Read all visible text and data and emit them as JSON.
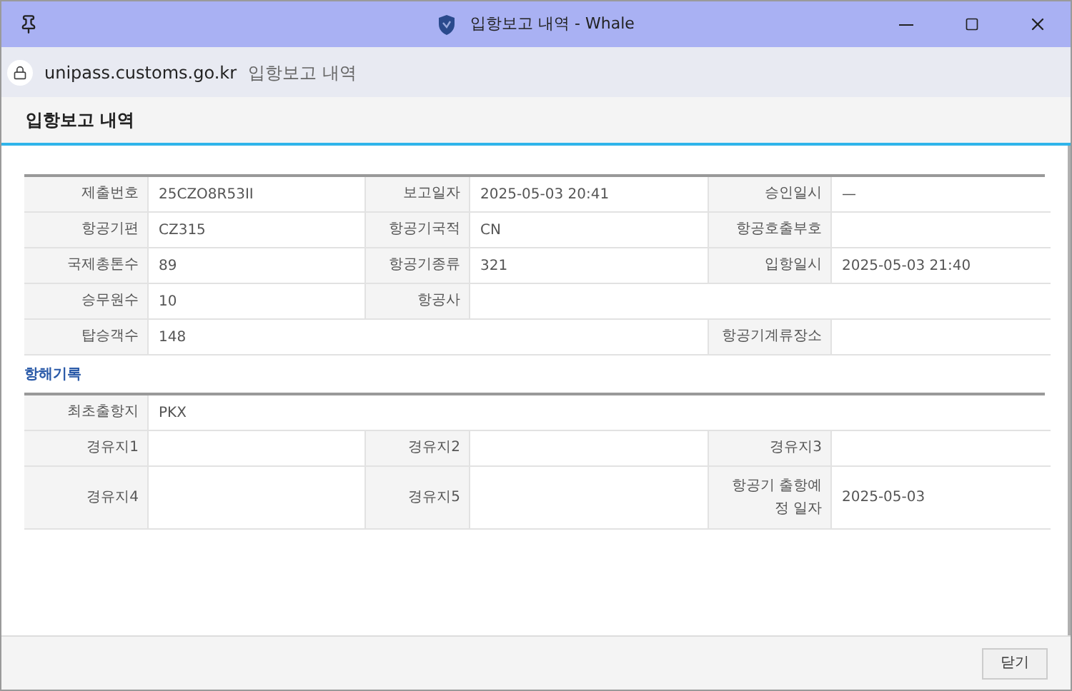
{
  "window": {
    "title": "입항보고 내역 - Whale"
  },
  "address_bar": {
    "url": "unipass.customs.go.kr",
    "page_title": "입항보고 내역"
  },
  "page": {
    "heading": "입항보고 내역"
  },
  "report_table": {
    "rows": [
      [
        {
          "kind": "label",
          "text": "제출번호"
        },
        {
          "kind": "value",
          "text": "25CZO8R53II"
        },
        {
          "kind": "label",
          "text": "보고일자"
        },
        {
          "kind": "value",
          "text": "2025-05-03 20:41"
        },
        {
          "kind": "label",
          "text": "승인일시"
        },
        {
          "kind": "value",
          "text": "—"
        }
      ],
      [
        {
          "kind": "label",
          "text": "항공기편"
        },
        {
          "kind": "value",
          "text": "CZ315"
        },
        {
          "kind": "label",
          "text": "항공기국적"
        },
        {
          "kind": "value",
          "text": "CN"
        },
        {
          "kind": "label",
          "text": "항공호출부호"
        },
        {
          "kind": "value",
          "text": ""
        }
      ],
      [
        {
          "kind": "label",
          "text": "국제총톤수"
        },
        {
          "kind": "value",
          "text": "89"
        },
        {
          "kind": "label",
          "text": "항공기종류"
        },
        {
          "kind": "value",
          "text": "321"
        },
        {
          "kind": "label",
          "text": "입항일시"
        },
        {
          "kind": "value",
          "text": "2025-05-03 21:40"
        }
      ],
      [
        {
          "kind": "label",
          "text": "승무원수"
        },
        {
          "kind": "value",
          "text": "10"
        },
        {
          "kind": "label",
          "text": "항공사"
        },
        {
          "kind": "value",
          "text": ""
        },
        {
          "kind": "value",
          "text": ""
        },
        {
          "kind": "value",
          "text": ""
        }
      ],
      [
        {
          "kind": "label",
          "text": "탑승객수"
        },
        {
          "kind": "value",
          "text": "148"
        },
        {
          "kind": "value",
          "text": ""
        },
        {
          "kind": "value",
          "text": ""
        },
        {
          "kind": "label",
          "text": "항공기계류장소"
        },
        {
          "kind": "value",
          "text": ""
        }
      ]
    ]
  },
  "route_section": {
    "title": "항해기록",
    "rows": [
      [
        {
          "kind": "label",
          "text": "최초출항지"
        },
        {
          "kind": "value",
          "text": "PKX"
        },
        {
          "kind": "value",
          "text": ""
        },
        {
          "kind": "value",
          "text": ""
        },
        {
          "kind": "value",
          "text": ""
        },
        {
          "kind": "value",
          "text": ""
        }
      ],
      [
        {
          "kind": "label",
          "text": "경유지1"
        },
        {
          "kind": "value",
          "text": ""
        },
        {
          "kind": "label",
          "text": "경유지2"
        },
        {
          "kind": "value",
          "text": ""
        },
        {
          "kind": "label",
          "text": "경유지3"
        },
        {
          "kind": "value",
          "text": ""
        }
      ],
      [
        {
          "kind": "label",
          "text": "경유지4"
        },
        {
          "kind": "value",
          "text": ""
        },
        {
          "kind": "label",
          "text": "경유지5"
        },
        {
          "kind": "value",
          "text": ""
        },
        {
          "kind": "label",
          "text": "항공기 출항예정 일자"
        },
        {
          "kind": "value",
          "text": "2025-05-03"
        }
      ]
    ]
  },
  "footer": {
    "close_button": "닫기"
  }
}
